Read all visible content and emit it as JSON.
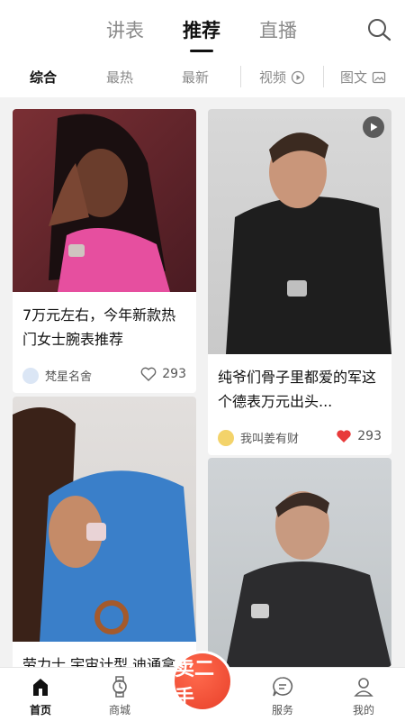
{
  "top_tabs": {
    "t1": "讲表",
    "t2": "推荐",
    "t3": "直播"
  },
  "sub_tabs": {
    "s1": "综合",
    "s2": "最热",
    "s3": "最新",
    "s4": "视频",
    "s5": "图文"
  },
  "feed": {
    "card1": {
      "title": "7万元左右，今年新款热门女士腕表推荐",
      "author": "梵星名舍",
      "likes": "293"
    },
    "card2": {
      "title": "纯爷们骨子里都爱的军这个德表万元出头...",
      "author": "我叫姜有财",
      "likes": "293",
      "has_video": true
    },
    "card3": {
      "title": "劳力士 宇宙计型 迪通拿",
      "author": "",
      "likes": ""
    },
    "card4": {
      "title": "",
      "author": "",
      "likes": ""
    }
  },
  "bottom_nav": {
    "home": "首页",
    "mall": "商城",
    "sell": "卖二手",
    "service": "服务",
    "mine": "我的"
  },
  "colors": {
    "accent": "#e8402a",
    "liked": "#e83a3a",
    "text": "#111111",
    "muted": "#8a8a8a"
  },
  "icons": [
    "search-icon",
    "play-circle-icon",
    "image-icon",
    "play-badge-icon",
    "heart-outline-icon",
    "heart-filled-icon",
    "home-icon",
    "watch-icon",
    "chat-icon",
    "user-icon"
  ]
}
